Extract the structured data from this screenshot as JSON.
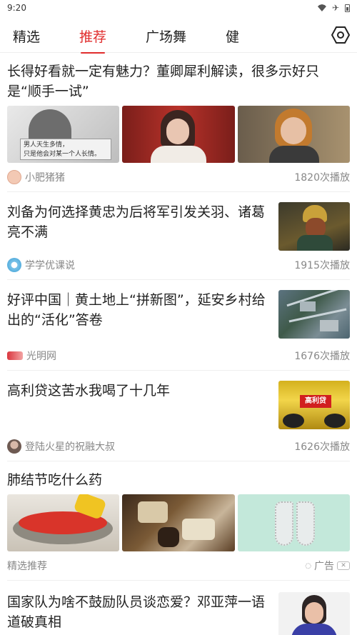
{
  "status": {
    "time": "9:20"
  },
  "tabs": [
    "精选",
    "推荐",
    "广场舞",
    "健"
  ],
  "feed": [
    {
      "title": "长得好看就一定有魅力？董卿犀利解读，很多示好只是“顺手一试”",
      "author": "小肥猪猪",
      "plays": "1820次播放",
      "image_caption": "男人天生多情，\n只是他会对某一个人长情。"
    },
    {
      "title": "刘备为何选择黄忠为后将军引发关羽、诸葛亮不满",
      "author": "学学优课说",
      "plays": "1915次播放"
    },
    {
      "title": "好评中国｜黄土地上“拼新图”，延安乡村给出的“活化”答卷",
      "author": "光明网",
      "plays": "1676次播放"
    },
    {
      "title": "高利贷这苦水我喝了十几年",
      "author": "登陆火星的祝融大叔",
      "plays": "1626次播放",
      "image_text": "高利贷"
    },
    {
      "title": "肺结节吃什么药",
      "author": "精选推荐",
      "ad_label": "广告"
    },
    {
      "title": "国家队为啥不鼓励队员谈恋爱？邓亚萍一语道破真相"
    }
  ]
}
